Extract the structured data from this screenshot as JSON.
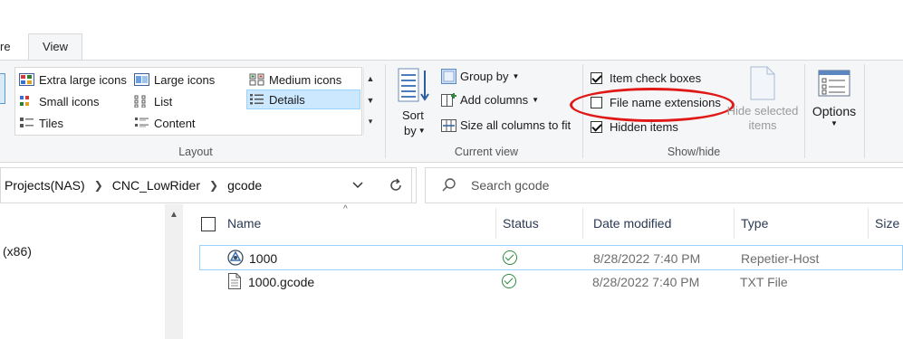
{
  "tabs": {
    "share_label": "re",
    "view_label": "View"
  },
  "ribbon": {
    "layout": {
      "group_label": "Layout",
      "items": [
        {
          "label": "Extra large icons",
          "icon": "extra-large-icons-icon"
        },
        {
          "label": "Large icons",
          "icon": "large-icons-icon"
        },
        {
          "label": "Medium icons",
          "icon": "medium-icons-icon"
        },
        {
          "label": "Small icons",
          "icon": "small-icons-icon"
        },
        {
          "label": "List",
          "icon": "list-icon"
        },
        {
          "label": "Details",
          "icon": "details-icon",
          "selected": true
        },
        {
          "label": "Tiles",
          "icon": "tiles-icon"
        },
        {
          "label": "Content",
          "icon": "content-icon"
        }
      ]
    },
    "current_view": {
      "group_label": "Current view",
      "sort_label": "Sort",
      "sort_by_label": "by",
      "group_by_label": "Group by",
      "add_columns_label": "Add columns",
      "size_all_columns_label": "Size all columns to fit"
    },
    "show_hide": {
      "group_label": "Show/hide",
      "item_check_boxes_label": "Item check boxes",
      "item_check_boxes_checked": true,
      "file_name_extensions_label": "File name extensions",
      "file_name_extensions_checked": false,
      "hidden_items_label": "Hidden items",
      "hidden_items_checked": true,
      "hide_selected_line1": "Hide selected",
      "hide_selected_line2": "items"
    },
    "options_label": "Options"
  },
  "address": {
    "crumbs": [
      "Projects(NAS)",
      "CNC_LowRider",
      "gcode"
    ],
    "search_placeholder": "Search gcode"
  },
  "nav": {
    "partial_item": "(x86)"
  },
  "columns": {
    "name": "Name",
    "status": "Status",
    "date_modified": "Date modified",
    "type": "Type",
    "size": "Size"
  },
  "files": [
    {
      "name": "1000",
      "date": "8/28/2022 7:40 PM",
      "type": "Repetier-Host",
      "icon": "repetier-host-icon",
      "selected": true
    },
    {
      "name": "1000.gcode",
      "date": "8/28/2022 7:40 PM",
      "type": "TXT File",
      "icon": "text-file-icon",
      "selected": false
    }
  ],
  "colors": {
    "accent_selection": "#cce8ff",
    "highlight_oval": "#e01818",
    "status_ok": "#2e8b3e"
  }
}
